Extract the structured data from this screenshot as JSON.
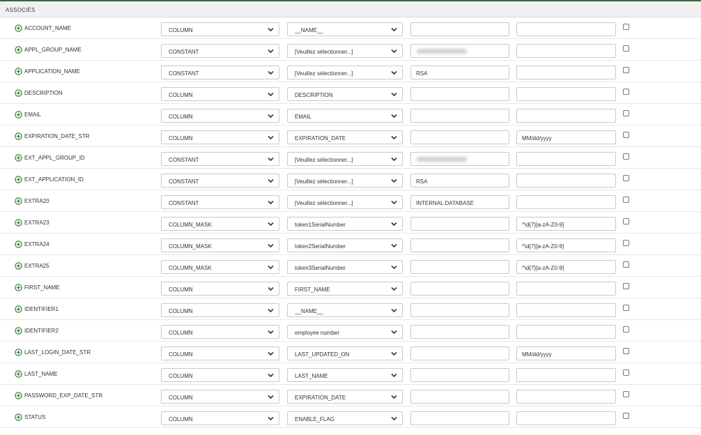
{
  "section": {
    "title": "ASSOCIÉS"
  },
  "rows": [
    {
      "name": "ACCOUNT_NAME",
      "type": "COLUMN",
      "value": "__NAME__",
      "input1": "",
      "input2": "",
      "input1_blurred": false
    },
    {
      "name": "APPL_GROUP_NAME",
      "type": "CONSTANT",
      "value": "[Veuillez sélectionner...]",
      "input1": "",
      "input2": "",
      "input1_blurred": true
    },
    {
      "name": "APPLICATION_NAME",
      "type": "CONSTANT",
      "value": "[Veuillez sélectionner...]",
      "input1": "RSA",
      "input2": "",
      "input1_blurred": false
    },
    {
      "name": "DESCRIPTION",
      "type": "COLUMN",
      "value": "DESCRIPTION",
      "input1": "",
      "input2": "",
      "input1_blurred": false
    },
    {
      "name": "EMAIL",
      "type": "COLUMN",
      "value": "EMAIL",
      "input1": "",
      "input2": "",
      "input1_blurred": false
    },
    {
      "name": "EXPIRATION_DATE_STR",
      "type": "COLUMN",
      "value": "EXPIRATION_DATE",
      "input1": "",
      "input2": "MM/dd/yyyy",
      "input1_blurred": false
    },
    {
      "name": "EXT_APPL_GROUP_ID",
      "type": "CONSTANT",
      "value": "[Veuillez sélectionner...]",
      "input1": "",
      "input2": "",
      "input1_blurred": true
    },
    {
      "name": "EXT_APPLICATION_ID",
      "type": "CONSTANT",
      "value": "[Veuillez sélectionner...]",
      "input1": "RSA",
      "input2": "",
      "input1_blurred": false
    },
    {
      "name": "EXTRA20",
      "type": "CONSTANT",
      "value": "[Veuillez sélectionner...]",
      "input1": "INTERNAL DATABASE",
      "input2": "",
      "input1_blurred": false
    },
    {
      "name": "EXTRA23",
      "type": "COLUMN_MASK",
      "value": "token1SerialNumber",
      "input1": "",
      "input2": "^\\d{7}[a-zA-Z0-9]",
      "input1_blurred": false
    },
    {
      "name": "EXTRA24",
      "type": "COLUMN_MASK",
      "value": "token2SerialNumber",
      "input1": "",
      "input2": "^\\d{7}[a-zA-Z0-9]",
      "input1_blurred": false
    },
    {
      "name": "EXTRA25",
      "type": "COLUMN_MASK",
      "value": "token3SerialNumber",
      "input1": "",
      "input2": "^\\d{7}[a-zA-Z0-9]",
      "input1_blurred": false
    },
    {
      "name": "FIRST_NAME",
      "type": "COLUMN",
      "value": "FIRST_NAME",
      "input1": "",
      "input2": "",
      "input1_blurred": false
    },
    {
      "name": "IDENTIFIER1",
      "type": "COLUMN",
      "value": "__NAME__",
      "input1": "",
      "input2": "",
      "input1_blurred": false
    },
    {
      "name": "IDENTIFIER2",
      "type": "COLUMN",
      "value": "employee number",
      "input1": "",
      "input2": "",
      "input1_blurred": false
    },
    {
      "name": "LAST_LOGIN_DATE_STR",
      "type": "COLUMN",
      "value": "LAST_UPDATED_ON",
      "input1": "",
      "input2": "MM/dd/yyyy",
      "input1_blurred": false
    },
    {
      "name": "LAST_NAME",
      "type": "COLUMN",
      "value": "LAST_NAME",
      "input1": "",
      "input2": "",
      "input1_blurred": false
    },
    {
      "name": "PASSWORD_EXP_DATE_STR",
      "type": "COLUMN",
      "value": "EXPIRATION_DATE",
      "input1": "",
      "input2": "",
      "input1_blurred": false
    },
    {
      "name": "STATUS",
      "type": "COLUMN",
      "value": "ENABLE_FLAG",
      "input1": "",
      "input2": "",
      "input1_blurred": false
    }
  ],
  "colors": {
    "accent": "#2e7d32",
    "header_border": "#2e6b3c",
    "header_bg": "#f0f0f0"
  },
  "icons": {
    "add": "plus-circle-icon",
    "dropdown": "chevron-down-icon"
  }
}
